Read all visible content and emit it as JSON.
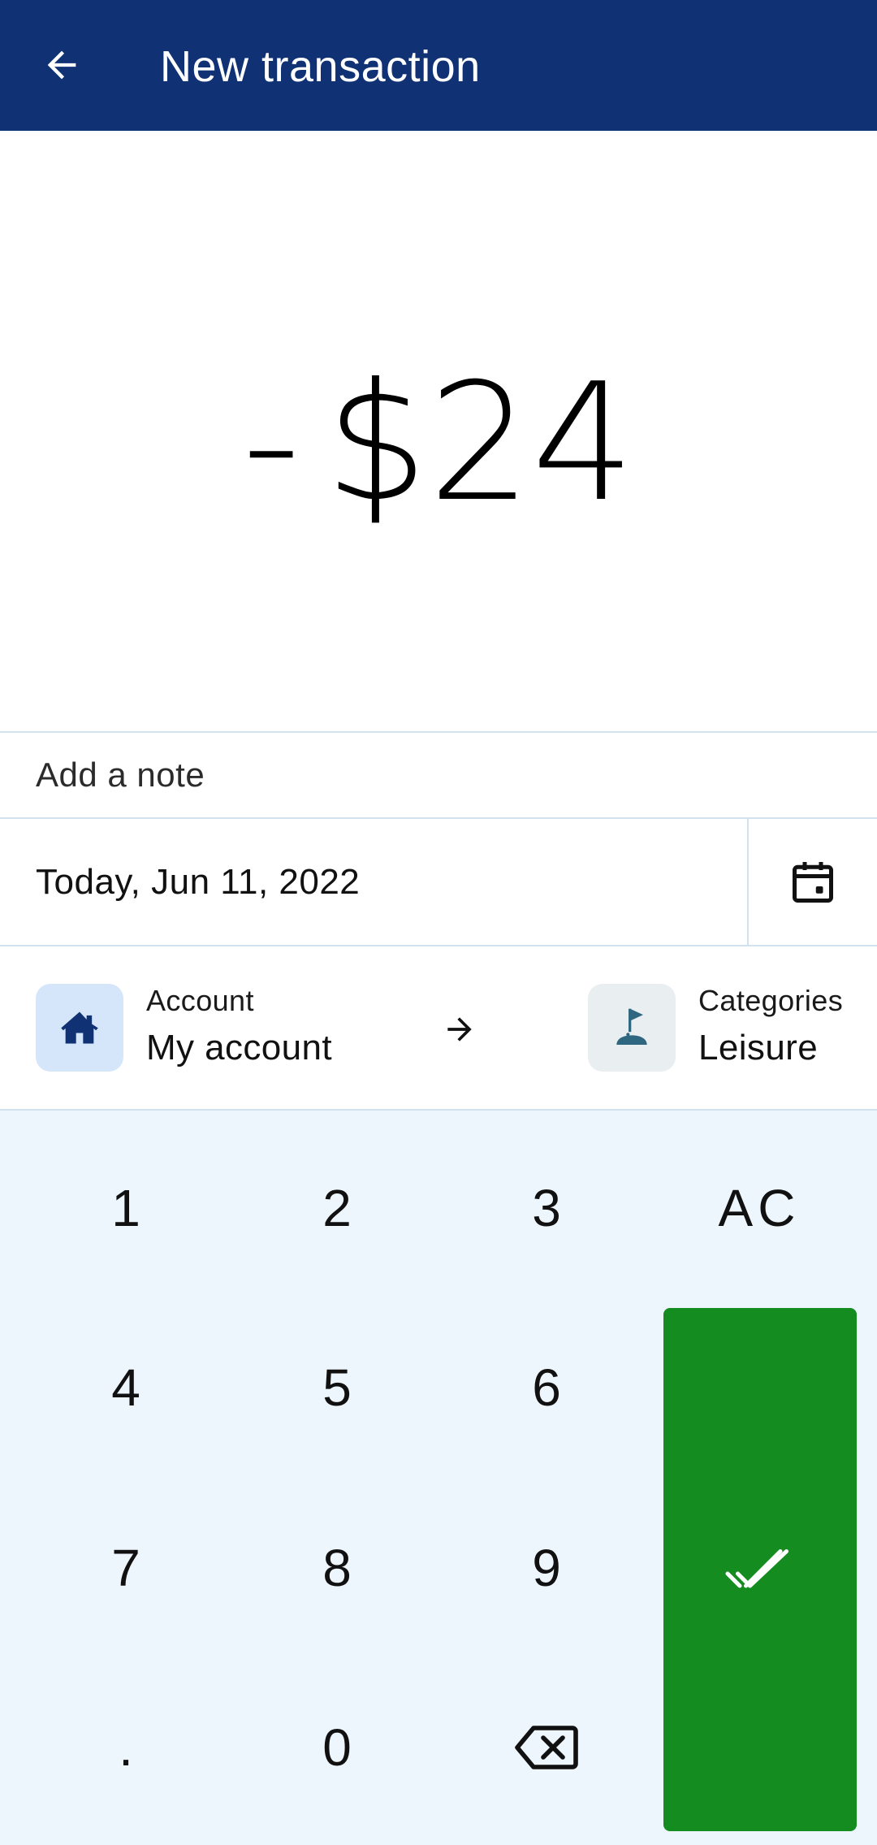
{
  "app_bar": {
    "title": "New transaction",
    "back_icon": "arrow-left-icon",
    "background": "#103174"
  },
  "amount": {
    "sign": "-",
    "value": "$24"
  },
  "note": {
    "placeholder": "Add a note"
  },
  "date": {
    "text": "Today, Jun 11, 2022",
    "calendar_icon": "calendar-icon"
  },
  "account": {
    "label": "Account",
    "value": "My account",
    "icon": "house-icon",
    "icon_bg": "#d5e6fb"
  },
  "transfer_arrow_icon": "arrow-right-icon",
  "category": {
    "label": "Categories",
    "value": "Leisure",
    "icon": "golf-flag-icon",
    "icon_bg": "#e9eef1"
  },
  "keypad": {
    "background": "#edf5fd",
    "keys": {
      "k1": "1",
      "k2": "2",
      "k3": "3",
      "clear": "AC",
      "k4": "4",
      "k5": "5",
      "k6": "6",
      "k7": "7",
      "k8": "8",
      "k9": "9",
      "dot": ".",
      "k0": "0"
    },
    "backspace_icon": "backspace-icon",
    "submit_icon": "double-check-icon",
    "submit_color": "#148c1f"
  }
}
